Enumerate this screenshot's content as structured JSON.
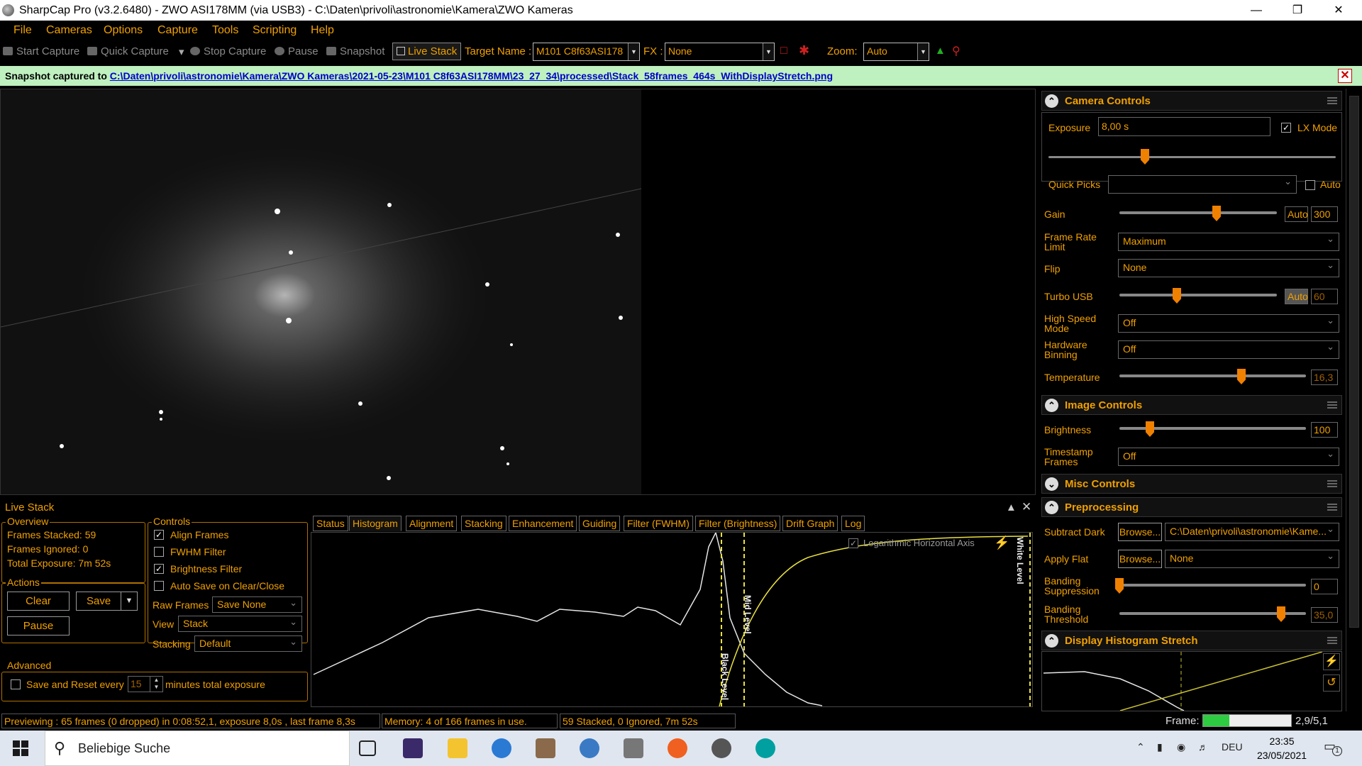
{
  "window": {
    "title": "SharpCap Pro (v3.2.6480) - ZWO ASI178MM (via USB3) - C:\\Daten\\privoli\\astronomie\\Kamera\\ZWO Kameras"
  },
  "menu": [
    "File",
    "Cameras",
    "Options",
    "Capture",
    "Tools",
    "Scripting",
    "Help"
  ],
  "toolbar": {
    "start_capture": "Start Capture",
    "quick_capture": "Quick Capture",
    "stop_capture": "Stop Capture",
    "pause": "Pause",
    "snapshot": "Snapshot",
    "live_stack": "Live Stack",
    "target_label": "Target Name :",
    "target_value": "M101 C8f63ASI178",
    "fx_label": "FX :",
    "fx_value": "None",
    "zoom_label": "Zoom:",
    "zoom_value": "Auto"
  },
  "notification": {
    "prefix": "Snapshot captured to ",
    "link1": "C:\\Daten\\privoli\\astronomie\\Kamera\\ZWO Kameras\\2021-05-23\\M101 C8f63ASI178MM\\23_27_34\\processed\\",
    "link2": "Stack_58frames_464s_WithDisplayStretch.png"
  },
  "livestack": {
    "title": "Live Stack",
    "overview": {
      "label": "Overview",
      "frames_stacked": "Frames Stacked: 59",
      "frames_ignored": "Frames Ignored:  0",
      "total_exposure": "Total Exposure:   7m 52s"
    },
    "actions": {
      "label": "Actions",
      "clear": "Clear",
      "save": "Save",
      "pause": "Pause"
    },
    "controls": {
      "label": "Controls",
      "align": "Align Frames",
      "fwhm": "FWHM Filter",
      "brightness": "Brightness Filter",
      "autosave": "Auto Save on Clear/Close",
      "raw_frames_label": "Raw Frames",
      "raw_frames_value": "Save None",
      "view_label": "View",
      "view_value": "Stack",
      "stacking_label": "Stacking",
      "stacking_value": "Default"
    },
    "advanced": {
      "label": "Advanced",
      "save_reset": "Save and Reset every",
      "minutes_value": "15",
      "minutes_suffix": "minutes total exposure"
    },
    "tabs": [
      "Status",
      "Histogram",
      "Alignment",
      "Stacking",
      "Enhancement",
      "Guiding",
      "Filter (FWHM)",
      "Filter (Brightness)",
      "Drift Graph",
      "Log"
    ],
    "histogram": {
      "log_axis": "Logarithmic Horizontal Axis",
      "black_level": "Black Level",
      "mid_level": "Mid Level",
      "white_level": "White Level"
    }
  },
  "status": {
    "preview": "Previewing : 65 frames (0 dropped) in 0:08:52,1, exposure 8,0s , last frame 8,3s",
    "memory": "Memory: 4 of 166 frames in use.",
    "stacked": "59 Stacked, 0 Ignored, 7m 52s",
    "frame_label": "Frame:",
    "frame_value": "2,9/5,1",
    "frame_progress": 0.3
  },
  "camera_controls": {
    "title": "Camera Controls",
    "exposure_label": "Exposure",
    "exposure_value": "8,00 s",
    "lx_mode": "LX Mode",
    "quick_picks": "Quick Picks",
    "auto": "Auto",
    "gain_label": "Gain",
    "gain_auto": "Auto",
    "gain_value": "300",
    "frame_rate_label": "Frame Rate Limit",
    "frame_rate_value": "Maximum",
    "flip_label": "Flip",
    "flip_value": "None",
    "turbo_label": "Turbo USB",
    "turbo_auto": "Auto",
    "turbo_value": "60",
    "hsm_label": "High Speed Mode",
    "hsm_value": "Off",
    "binning_label": "Hardware Binning",
    "binning_value": "Off",
    "temp_label": "Temperature",
    "temp_value": "16,3"
  },
  "image_controls": {
    "title": "Image Controls",
    "brightness_label": "Brightness",
    "brightness_value": "100",
    "timestamp_label": "Timestamp Frames",
    "timestamp_value": "Off"
  },
  "misc_controls": {
    "title": "Misc Controls"
  },
  "preprocessing": {
    "title": "Preprocessing",
    "subtract_dark": "Subtract Dark",
    "browse": "Browse...",
    "dark_value": "C:\\Daten\\privoli\\astronomie\\Kame...",
    "apply_flat": "Apply Flat",
    "flat_value": "None",
    "banding_supp": "Banding Suppression",
    "banding_supp_value": "0",
    "banding_thr": "Banding Threshold",
    "banding_thr_value": "35,0"
  },
  "display_stretch": {
    "title": "Display Histogram Stretch"
  },
  "taskbar": {
    "search": "Beliebige Suche",
    "lang": "DEU",
    "time": "23:35",
    "date": "23/05/2021",
    "notif": "1"
  },
  "colors": {
    "accent": "#f0a000",
    "notify_bg": "#bff0bf",
    "histogram_line": "#e6e6e6",
    "level_line": "#e8e040"
  }
}
